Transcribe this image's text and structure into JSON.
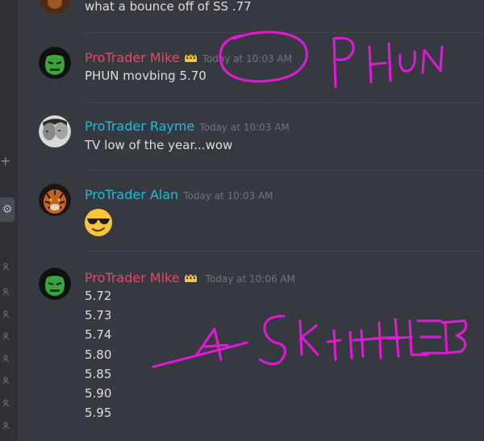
{
  "sidebar": {
    "plus_glyph": "+",
    "gear_glyph": "⚙"
  },
  "messages": [
    {
      "text": "what a bounce off of SS .77"
    },
    {
      "author": "ProTrader Mike",
      "timestamp": "Today at 10:03 AM",
      "text": "PHUN movbing  5.70"
    },
    {
      "author": "ProTrader Rayme",
      "timestamp": "Today at 10:03 AM",
      "text": "TV low of the year...wow"
    },
    {
      "author": "ProTrader Alan",
      "timestamp": "Today at 10:03 AM",
      "emoji": "sunglasses-emoji"
    },
    {
      "author": "ProTrader Mike",
      "timestamp": "Today at 10:06 AM",
      "lines": [
        "5.72",
        "5.73",
        "5.74",
        "5.80",
        "5.85",
        "5.90",
        "5.95"
      ]
    }
  ],
  "colors": {
    "background": "#36393f",
    "mike_name": "#e04a6b",
    "cyan_name": "#1fbce0",
    "annotation": "#e01ad8"
  }
}
